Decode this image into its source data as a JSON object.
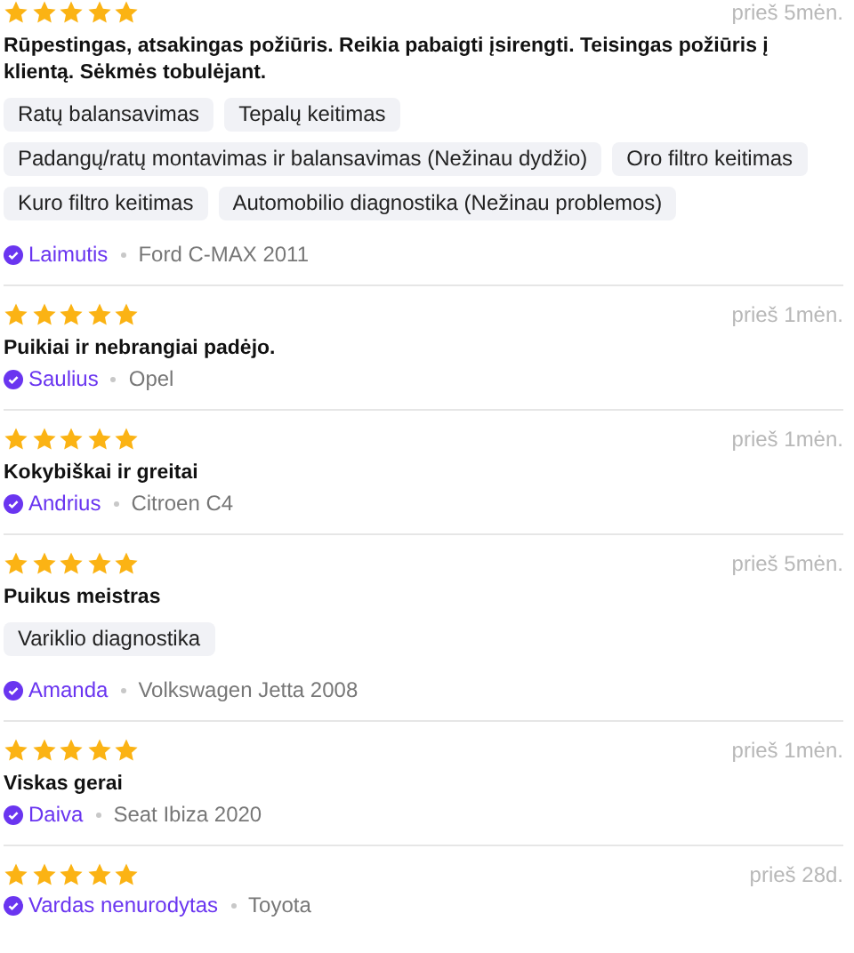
{
  "reviews": [
    {
      "stars": 5,
      "time": "prieš 5mėn.",
      "text": "Rūpestingas, atsakingas požiūris. Reikia pabaigti įsirengti. Teisingas požiūris į klientą. Sėkmės tobulėjant.",
      "tags": [
        "Ratų balansavimas",
        "Tepalų keitimas",
        "Padangų/ratų montavimas ir balansavimas (Nežinau dydžio)",
        "Oro filtro keitimas",
        "Kuro filtro keitimas",
        "Automobilio diagnostika (Nežinau problemos)"
      ],
      "author": "Laimutis",
      "car": "Ford C-MAX 2011"
    },
    {
      "stars": 5,
      "time": "prieš 1mėn.",
      "text": "Puikiai ir nebrangiai padėjo.",
      "author": "Saulius",
      "car": "Opel"
    },
    {
      "stars": 5,
      "time": "prieš 1mėn.",
      "text": "Kokybiškai ir greitai",
      "author": "Andrius",
      "car": "Citroen C4"
    },
    {
      "stars": 5,
      "time": "prieš 5mėn.",
      "text": "Puikus meistras",
      "tags": [
        "Variklio diagnostika"
      ],
      "author": "Amanda",
      "car": "Volkswagen Jetta 2008"
    },
    {
      "stars": 5,
      "time": "prieš 1mėn.",
      "text": "Viskas gerai",
      "author": "Daiva",
      "car": "Seat Ibiza 2020"
    },
    {
      "stars": 5,
      "time": "prieš 28d.",
      "author": "Vardas nenurodytas",
      "car": "Toyota"
    }
  ]
}
